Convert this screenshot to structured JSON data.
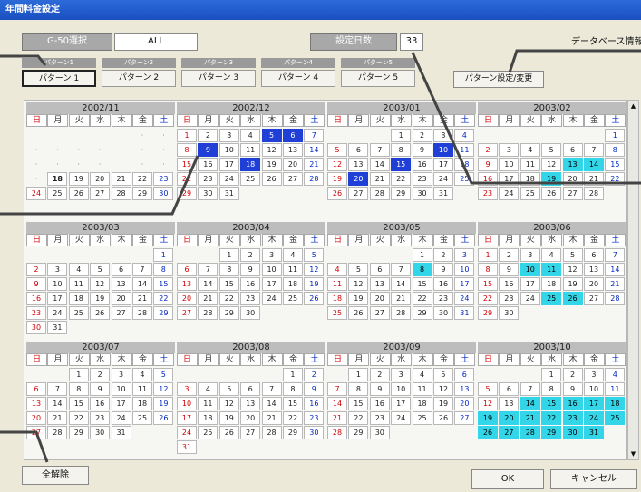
{
  "window": {
    "title": "年間料金設定"
  },
  "g50": {
    "label": "G-50選択",
    "value": "ALL"
  },
  "days": {
    "label": "設定日数",
    "value": "33"
  },
  "db_label": "データベース情報",
  "patterns": [
    {
      "tab": "パターン1",
      "label": "パターン 1"
    },
    {
      "tab": "パターン2",
      "label": "パターン 2"
    },
    {
      "tab": "パターン3",
      "label": "パターン 3"
    },
    {
      "tab": "パターン4",
      "label": "パターン 4"
    },
    {
      "tab": "パターン5",
      "label": "パターン 5"
    }
  ],
  "buttons": {
    "change": "パターン設定/変更",
    "clear": "全解除",
    "ok": "OK",
    "cancel": "キャンセル"
  },
  "weekdays": [
    "日",
    "月",
    "火",
    "水",
    "木",
    "金",
    "土"
  ],
  "colors": {
    "selected_blue": "#1f3fd6",
    "selected_cyan": "#33d6e8",
    "sunday": "#d40000",
    "saturday": "#0027c2"
  },
  "months": [
    {
      "title": "2002/11",
      "offset": 5,
      "days": 30,
      "bold": [
        18
      ],
      "dots": [
        1,
        2,
        3,
        4,
        5,
        6,
        7,
        8,
        9,
        10,
        11,
        12,
        13,
        14,
        15,
        16,
        17
      ],
      "blue": [],
      "cyan": []
    },
    {
      "title": "2002/12",
      "offset": 0,
      "days": 31,
      "bold": [],
      "dots": [],
      "blue": [
        5,
        6,
        9,
        18
      ],
      "cyan": []
    },
    {
      "title": "2003/01",
      "offset": 3,
      "days": 31,
      "bold": [],
      "dots": [],
      "blue": [
        10,
        15,
        20
      ],
      "cyan": []
    },
    {
      "title": "2003/02",
      "offset": 6,
      "days": 28,
      "bold": [],
      "dots": [],
      "blue": [],
      "cyan": [
        13,
        14,
        19
      ]
    },
    {
      "title": "2003/03",
      "offset": 6,
      "days": 31,
      "bold": [],
      "dots": [],
      "blue": [],
      "cyan": []
    },
    {
      "title": "2003/04",
      "offset": 2,
      "days": 30,
      "bold": [],
      "dots": [],
      "blue": [],
      "cyan": []
    },
    {
      "title": "2003/05",
      "offset": 4,
      "days": 31,
      "bold": [],
      "dots": [],
      "blue": [],
      "cyan": [
        8
      ]
    },
    {
      "title": "2003/06",
      "offset": 0,
      "days": 30,
      "bold": [],
      "dots": [],
      "blue": [],
      "cyan": [
        10,
        11,
        25,
        26
      ]
    },
    {
      "title": "2003/07",
      "offset": 2,
      "days": 31,
      "bold": [],
      "dots": [],
      "blue": [],
      "cyan": []
    },
    {
      "title": "2003/08",
      "offset": 5,
      "days": 31,
      "bold": [],
      "dots": [],
      "blue": [],
      "cyan": []
    },
    {
      "title": "2003/09",
      "offset": 1,
      "days": 30,
      "bold": [],
      "dots": [],
      "blue": [],
      "cyan": []
    },
    {
      "title": "2003/10",
      "offset": 3,
      "days": 31,
      "bold": [],
      "dots": [],
      "blue": [],
      "cyan": [
        14,
        15,
        16,
        17,
        18,
        19,
        20,
        21,
        22,
        23,
        24,
        25,
        26,
        27,
        28,
        29,
        30,
        31
      ]
    }
  ]
}
